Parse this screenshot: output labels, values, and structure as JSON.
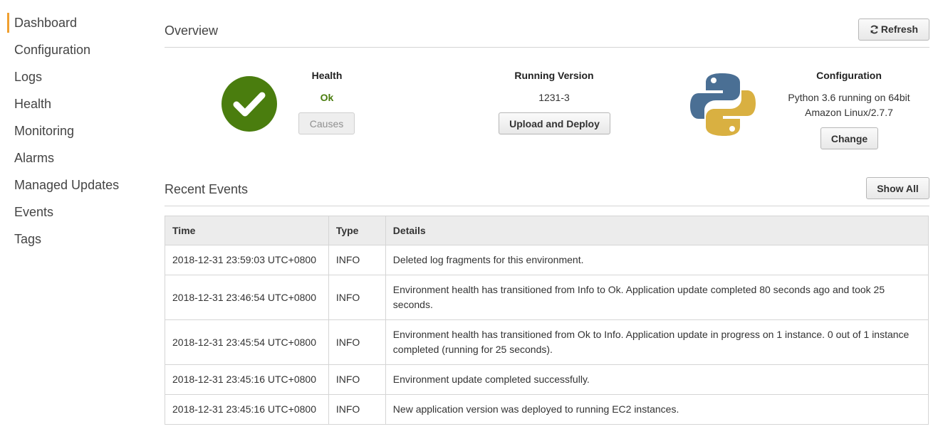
{
  "sidebar": {
    "items": [
      {
        "label": "Dashboard",
        "active": true
      },
      {
        "label": "Configuration"
      },
      {
        "label": "Logs"
      },
      {
        "label": "Health"
      },
      {
        "label": "Monitoring"
      },
      {
        "label": "Alarms"
      },
      {
        "label": "Managed Updates"
      },
      {
        "label": "Events"
      },
      {
        "label": "Tags"
      }
    ]
  },
  "overview": {
    "title": "Overview",
    "refresh_label": "Refresh",
    "health": {
      "title": "Health",
      "status": "Ok",
      "causes_label": "Causes",
      "icon": "checkmark-circle-icon",
      "color": "#4a7d0e"
    },
    "version": {
      "title": "Running Version",
      "value": "1231-3",
      "deploy_label": "Upload and Deploy"
    },
    "configuration": {
      "title": "Configuration",
      "line1": "Python 3.6 running on 64bit",
      "line2": "Amazon Linux/2.7.7",
      "change_label": "Change",
      "icon": "python-logo-icon"
    }
  },
  "events": {
    "title": "Recent Events",
    "show_all_label": "Show All",
    "columns": [
      "Time",
      "Type",
      "Details"
    ],
    "rows": [
      {
        "time": "2018-12-31 23:59:03 UTC+0800",
        "type": "INFO",
        "details": "Deleted log fragments for this environment."
      },
      {
        "time": "2018-12-31 23:46:54 UTC+0800",
        "type": "INFO",
        "details": "Environment health has transitioned from Info to Ok. Application update completed 80 seconds ago and took 25 seconds."
      },
      {
        "time": "2018-12-31 23:45:54 UTC+0800",
        "type": "INFO",
        "details": "Environment health has transitioned from Ok to Info. Application update in progress on 1 instance. 0 out of 1 instance completed (running for 25 seconds)."
      },
      {
        "time": "2018-12-31 23:45:16 UTC+0800",
        "type": "INFO",
        "details": "Environment update completed successfully."
      },
      {
        "time": "2018-12-31 23:45:16 UTC+0800",
        "type": "INFO",
        "details": "New application version was deployed to running EC2 instances."
      }
    ]
  },
  "colors": {
    "accent": "#f0a030",
    "ok": "#4a7d0e",
    "python_blue": "#4a6f94",
    "python_yellow": "#d9b041"
  }
}
